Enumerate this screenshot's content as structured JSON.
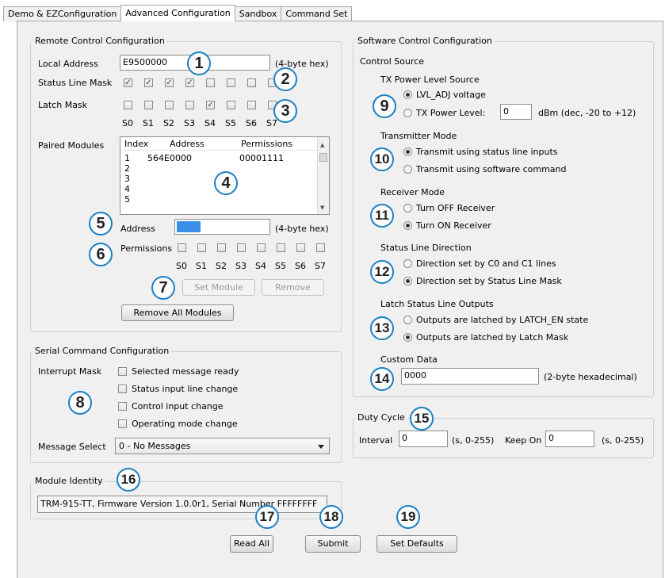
{
  "tabs": [
    "Demo & EZConfiguration",
    "Advanced Configuration",
    "Sandbox",
    "Command Set"
  ],
  "active_tab": "Advanced Configuration",
  "remote": {
    "title": "Remote Control Configuration",
    "local_address_label": "Local Address",
    "local_address_value": "E9500000",
    "local_address_hint": "(4-byte hex)",
    "status_mask_label": "Status Line Mask",
    "status_mask": [
      true,
      true,
      true,
      true,
      false,
      false,
      false,
      false
    ],
    "latch_mask_label": "Latch Mask",
    "latch_mask": [
      false,
      false,
      false,
      false,
      true,
      false,
      false,
      false
    ],
    "bit_labels": [
      "S0",
      "S1",
      "S2",
      "S3",
      "S4",
      "S5",
      "S6",
      "S7"
    ],
    "paired_label": "Paired Modules",
    "paired_columns": [
      "Index",
      "Address",
      "Permissions"
    ],
    "paired_rows": [
      {
        "index": "1",
        "address": "564E0000",
        "permissions": "00001111"
      },
      {
        "index": "2",
        "address": "",
        "permissions": ""
      },
      {
        "index": "3",
        "address": "",
        "permissions": ""
      },
      {
        "index": "4",
        "address": "",
        "permissions": ""
      },
      {
        "index": "5",
        "address": "",
        "permissions": ""
      }
    ],
    "address_label": "Address",
    "address_hint": "(4-byte hex)",
    "permissions_label": "Permissions",
    "set_module": "Set Module",
    "remove": "Remove",
    "remove_all": "Remove All Modules"
  },
  "serial": {
    "title": "Serial Command Configuration",
    "interrupt_label": "Interrupt Mask",
    "interrupts": [
      "Selected message ready",
      "Status input line change",
      "Control input change",
      "Operating mode change"
    ],
    "message_label": "Message Select",
    "message_value": "0 - No Messages"
  },
  "identity": {
    "title": "Module Identity",
    "value": "TRM-915-TT, Firmware Version 1.0.0r1, Serial Number FFFFFFFF"
  },
  "software": {
    "title": "Software Control Configuration",
    "control_source": "Control Source",
    "tx_power_title": "TX Power Level Source",
    "tx_opt1": "LVL_ADJ voltage",
    "tx_opt2": "TX Power Level:",
    "tx_power_value": "0",
    "tx_power_hint": "dBm (dec, -20 to +12)",
    "tx_mode_title": "Transmitter Mode",
    "tx_mode_opt1": "Transmit using status line inputs",
    "tx_mode_opt2": "Transmit using software command",
    "rx_mode_title": "Receiver Mode",
    "rx_opt1": "Turn OFF Receiver",
    "rx_opt2": "Turn ON Receiver",
    "dir_title": "Status Line Direction",
    "dir_opt1": "Direction set by C0 and C1 lines",
    "dir_opt2": "Direction set by Status Line Mask",
    "latch_title": "Latch Status Line Outputs",
    "latch_opt1": "Outputs are latched by LATCH_EN state",
    "latch_opt2": "Outputs are latched by Latch Mask",
    "custom_title": "Custom Data",
    "custom_value": "0000",
    "custom_hint": "(2-byte hexadecimal)"
  },
  "duty": {
    "title": "Duty Cycle",
    "interval_label": "Interval",
    "interval_value": "0",
    "interval_hint": "(s, 0-255)",
    "keepon_label": "Keep On",
    "keepon_value": "0",
    "keepon_hint": "(s, 0-255)"
  },
  "buttons": {
    "read_all": "Read All",
    "submit": "Submit",
    "set_defaults": "Set Defaults"
  },
  "callouts": [
    "1",
    "2",
    "3",
    "4",
    "5",
    "6",
    "7",
    "8",
    "9",
    "10",
    "11",
    "12",
    "13",
    "14",
    "15",
    "16",
    "17",
    "18",
    "19"
  ],
  "colors": {
    "callout_border": "#1a7fc4",
    "selection": "#3b8fe6",
    "panel": "#f0f0f0"
  }
}
